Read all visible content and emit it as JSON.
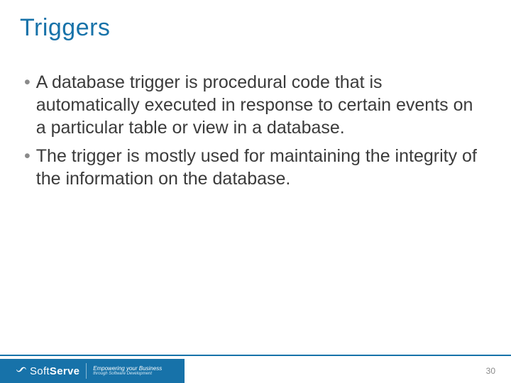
{
  "title": "Triggers",
  "bullets": [
    "A database trigger is procedural code that is automatically executed in response to certain events on a particular table or view in a database.",
    "The trigger is mostly used for maintaining the integrity of the information on the database."
  ],
  "footer": {
    "brand_soft": "Soft",
    "brand_serve": "Serve",
    "tagline_main": "Empowering your Business",
    "tagline_sub": "through Software Development",
    "page_number": "30"
  }
}
